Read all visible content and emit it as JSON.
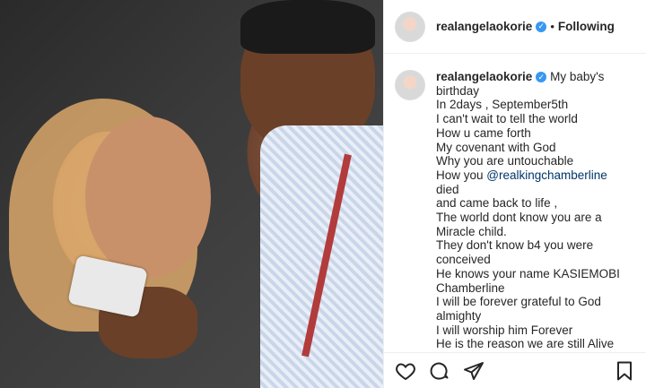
{
  "post": {
    "username": "realangelaokorie",
    "follow_state": "Following",
    "separator": "•",
    "verified_mark": "✓",
    "caption_lines": [
      "My baby's",
      "birthday",
      "In 2days , September5th",
      "I can't wait to tell the world",
      "How u came forth",
      "My covenant with God",
      "Why you are untouchable",
      "How you @realkingchamberline died",
      "and came back to life ,",
      "The world dont know you are a",
      "Miracle child.",
      "They don't know b4 you were",
      "conceived",
      "He knows your name KASIEMOBI",
      "Chamberline",
      "I will be forever grateful to God",
      "almighty",
      "I will worship him Forever",
      "He is the reason we are still Alive"
    ],
    "mention": "@realkingchamberline"
  },
  "icons": {
    "like": "heart-icon",
    "comment": "comment-icon",
    "share": "share-icon",
    "save": "bookmark-icon"
  }
}
